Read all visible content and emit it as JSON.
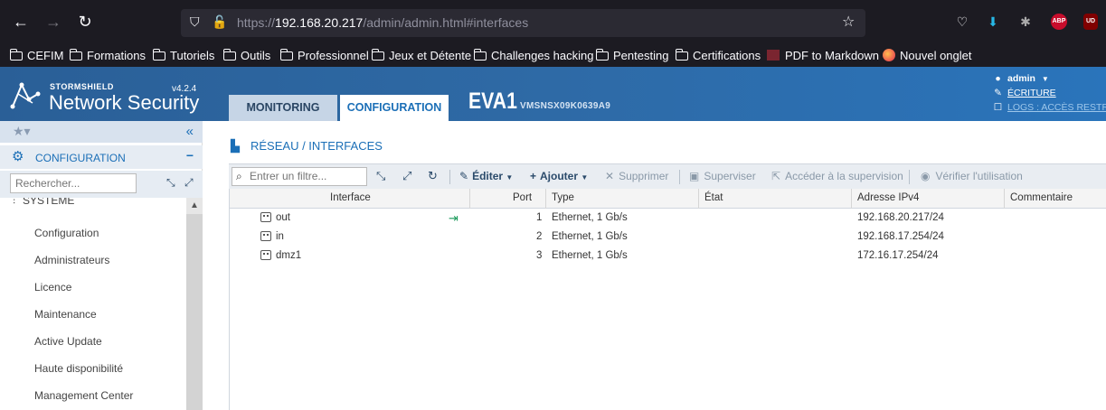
{
  "browser": {
    "url_prefix": "https://",
    "url_host": "192.168.20.217",
    "url_path": "/admin/admin.html#interfaces"
  },
  "bookmarks": [
    {
      "label": "CEFIM",
      "icon": "folder-icon"
    },
    {
      "label": "Formations",
      "icon": "folder-icon"
    },
    {
      "label": "Tutoriels",
      "icon": "folder-icon"
    },
    {
      "label": "Outils",
      "icon": "folder-icon"
    },
    {
      "label": "Professionnel",
      "icon": "folder-icon"
    },
    {
      "label": "Jeux et Détente",
      "icon": "folder-icon"
    },
    {
      "label": "Challenges hacking",
      "icon": "folder-icon"
    },
    {
      "label": "Pentesting",
      "icon": "folder-icon"
    },
    {
      "label": "Certifications",
      "icon": "folder-icon"
    },
    {
      "label": "PDF to Markdown",
      "icon": "pdf-icon"
    },
    {
      "label": "Nouvel onglet",
      "icon": "firefox-icon"
    }
  ],
  "extensions": {
    "abp": "ABP",
    "ud": "UD"
  },
  "header": {
    "brand": "STORMSHIELD",
    "product": "Network Security",
    "version": "v4.2.4",
    "tabs": {
      "monitoring": "MONITORING",
      "configuration": "CONFIGURATION"
    },
    "firewall_name": "EVA1",
    "serial": "VMSNSX09K0639A9",
    "user": "admin",
    "access_mode": "ÉCRITURE",
    "logs_access": "LOGS : ACCÈS RESTREINT"
  },
  "sidebar": {
    "section_label": "CONFIGURATION",
    "search_placeholder": "Rechercher...",
    "group_label": "SYSTÈME",
    "items": [
      "Configuration",
      "Administrateurs",
      "Licence",
      "Maintenance",
      "Active Update",
      "Haute disponibilité",
      "Management Center"
    ]
  },
  "main": {
    "title": "RÉSEAU / INTERFACES",
    "filter_placeholder": "Entrer un filtre...",
    "toolbar": {
      "edit": "Éditer",
      "add": "Ajouter",
      "delete": "Supprimer",
      "supervise": "Superviser",
      "goto_supervision": "Accéder à la supervision",
      "check_usage": "Vérifier l'utilisation"
    },
    "columns": [
      "Interface",
      "Port",
      "Type",
      "État",
      "Adresse IPv4",
      "Commentaire"
    ],
    "rows": [
      {
        "interface": "out",
        "port": "1",
        "type": "Ethernet, 1 Gb/s",
        "state": "",
        "ipv4": "192.168.20.217/24",
        "comment": ""
      },
      {
        "interface": "in",
        "port": "2",
        "type": "Ethernet, 1 Gb/s",
        "state": "",
        "ipv4": "192.168.17.254/24",
        "comment": ""
      },
      {
        "interface": "dmz1",
        "port": "3",
        "type": "Ethernet, 1 Gb/s",
        "state": "",
        "ipv4": "172.16.17.254/24",
        "comment": ""
      }
    ]
  },
  "colors": {
    "accent": "#1b6fb7",
    "header_blue": "#2e6aa6",
    "browser_dark": "#1c1b22"
  }
}
